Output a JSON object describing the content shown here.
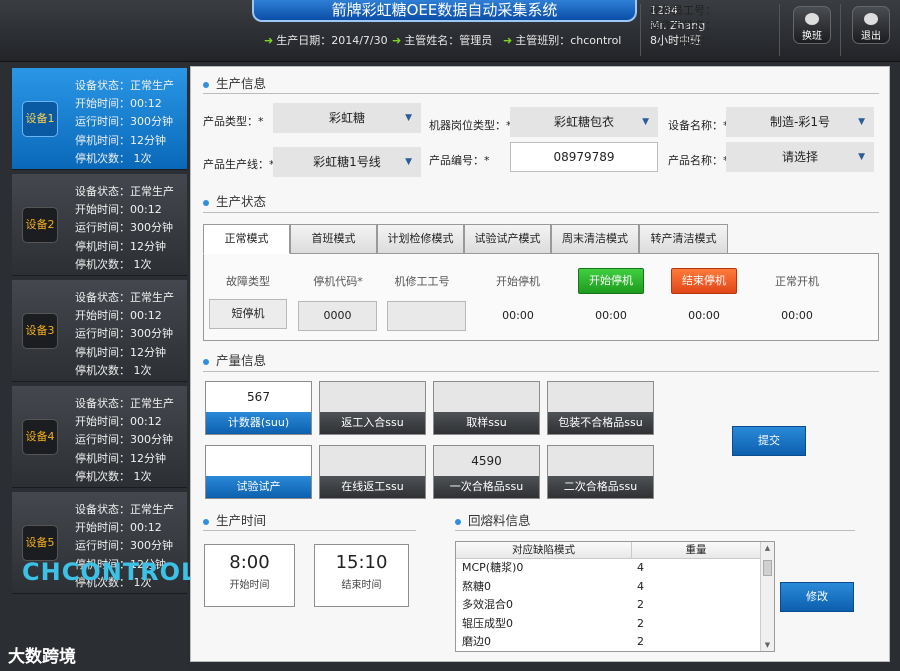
{
  "header": {
    "title": "箭牌彩虹糖OEE数据自动采集系统",
    "date_label": "生产日期：2014/7/30",
    "supervisor_label": "主管姓名：管理员",
    "shift_label": "主管班别：chcontrol",
    "operator_id_label": "操作员工号：",
    "operator_id": "1234",
    "operator_name_label": "操作员姓名：",
    "operator_name": "Mr. Zhang",
    "shift_time_label": "班次：",
    "shift_time": "8小时中班",
    "switch_btn": "换班",
    "exit_btn": "退出"
  },
  "sidebar": {
    "devices": [
      {
        "name": "设备1",
        "status": "设备状态：正常生产",
        "start": "开始时间：00:12",
        "run": "运行时间：300分钟",
        "stop": "停机时间：12分钟",
        "stops": "停机次数： 1次"
      },
      {
        "name": "设备2",
        "status": "设备状态：正常生产",
        "start": "开始时间：00:12",
        "run": "运行时间：300分钟",
        "stop": "停机时间：12分钟",
        "stops": "停机次数： 1次"
      },
      {
        "name": "设备3",
        "status": "设备状态：正常生产",
        "start": "开始时间：00:12",
        "run": "运行时间：300分钟",
        "stop": "停机时间：12分钟",
        "stops": "停机次数： 1次"
      },
      {
        "name": "设备4",
        "status": "设备状态：正常生产",
        "start": "开始时间：00:12",
        "run": "运行时间：300分钟",
        "stop": "停机时间：12分钟",
        "stops": "停机次数： 1次"
      },
      {
        "name": "设备5",
        "status": "设备状态：正常生产",
        "start": "开始时间：00:12",
        "run": "运行时间：300分钟",
        "stop": "停机时间：12分钟",
        "stops": "停机次数： 1次"
      }
    ],
    "logo": "CHCONTROL",
    "watermark": "大数跨境"
  },
  "production_info": {
    "title": "生产信息",
    "product_type_label": "产品类型：*",
    "product_type": "彩虹糖",
    "machine_post_label": "机器岗位类型：*",
    "machine_post": "彩虹糖包衣",
    "device_name_label": "设备名称：*",
    "device_name": "制造-彩1号",
    "line_label": "产品生产线：*",
    "line": "彩虹糖1号线",
    "product_no_label": "产品编号：*",
    "product_no": "08979789",
    "product_name_label": "产品名称：*",
    "product_name": "请选择"
  },
  "production_status": {
    "title": "生产状态",
    "tabs": [
      "正常模式",
      "首班模式",
      "计划检修模式",
      "试验试产模式",
      "周末清洁模式",
      "转产清洁模式"
    ],
    "fault_type_label": "故障类型",
    "fault_type": "短停机",
    "stop_code_label": "停机代码*",
    "stop_code": "0000",
    "repair_id_label": "机修工工号",
    "repair_id": "",
    "start_stop_label": "开始停机",
    "start_stop": "00:00",
    "start_stop_btn": "开始停机",
    "start_stop_time": "00:00",
    "end_stop_btn": "结束停机",
    "end_stop_time": "00:00",
    "normal_start_label": "正常开机",
    "normal_start": "00:00"
  },
  "output_info": {
    "title": "产量信息",
    "counters": [
      {
        "value": "567",
        "label": "计数器(suu)"
      },
      {
        "value": "",
        "label": "返工入合ssu"
      },
      {
        "value": "",
        "label": "取样ssu"
      },
      {
        "value": "",
        "label": "包装不合格品ssu"
      },
      {
        "value": "",
        "label": "试验试产"
      },
      {
        "value": "",
        "label": "在线返工ssu"
      },
      {
        "value": "4590",
        "label": "一次合格品ssu"
      },
      {
        "value": "",
        "label": "二次合格品ssu"
      }
    ],
    "submit": "提交"
  },
  "production_time": {
    "title": "生产时间",
    "start_value": "8:00",
    "start_label": "开始时间",
    "end_value": "15:10",
    "end_label": "结束时间"
  },
  "rework_info": {
    "title": "回熔料信息",
    "columns": [
      "对应缺陷模式",
      "重量"
    ],
    "rows": [
      [
        "MCP(糖浆)0",
        "4"
      ],
      [
        "熬糖0",
        "4"
      ],
      [
        "多效混合0",
        "2"
      ],
      [
        "辊压成型0",
        "2"
      ],
      [
        "磨边0",
        "2"
      ]
    ],
    "modify": "修改"
  },
  "colors": {
    "accent_blue": "#0c5fae",
    "start_green": "#1e9b1e",
    "end_orange": "#e1461a",
    "device_badge_text": "#f3b11d"
  }
}
